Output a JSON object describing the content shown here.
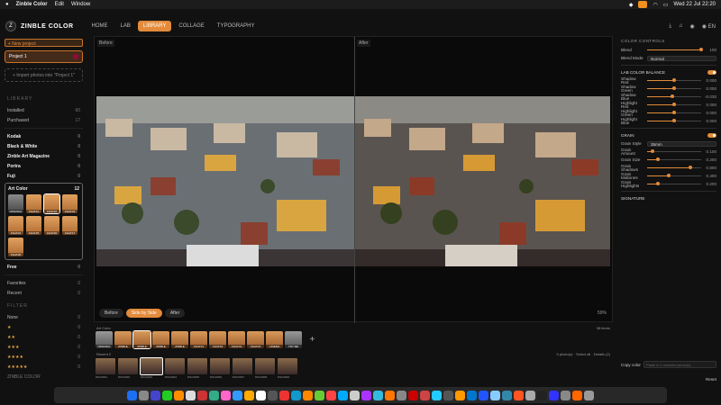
{
  "menubar": {
    "apple": "",
    "app_name": "Zinble Color",
    "items": [
      "Edit",
      "Window"
    ],
    "clock": "Wed 22 Jul 22:20"
  },
  "nav": {
    "brand": "ZINBLE COLOR",
    "tabs": [
      "HOME",
      "LAB",
      "LIBRARY",
      "COLLAGE",
      "TYPOGRAPHY"
    ],
    "active_tab": "LIBRARY",
    "lang": "EN"
  },
  "sidebar": {
    "new_project": "+ New project",
    "project": "Project 1",
    "import": "+ Import photos into \"Project 1\"",
    "library_title": "LIBRARY",
    "library": [
      {
        "label": "Installed",
        "count": "60"
      },
      {
        "label": "Purchased",
        "count": "17"
      }
    ],
    "groups": [
      {
        "label": "Kodak",
        "count": "0"
      },
      {
        "label": "Black & White",
        "count": "0"
      },
      {
        "label": "Zinble Art Magazine",
        "count": "0"
      },
      {
        "label": "Portra",
        "count": "0"
      },
      {
        "label": "Fuji",
        "count": "0"
      }
    ],
    "art_color": {
      "title": "Art Color",
      "count": "12",
      "thumbs": [
        "ORIGINAL",
        "FILM 01",
        "FILM 02",
        "FILM 03",
        "FILM 04",
        "FILM 05",
        "FILM 06",
        "FILM 07",
        "FILM 08",
        "",
        "",
        ""
      ]
    },
    "free": {
      "label": "Free",
      "count": "0"
    },
    "extra": [
      {
        "label": "Favorites",
        "count": "0"
      },
      {
        "label": "Recent",
        "count": "0"
      }
    ],
    "filter_title": "FILTER",
    "filter": [
      {
        "label": "None",
        "count": "0"
      },
      {
        "label": "★",
        "count": "0"
      },
      {
        "label": "★★",
        "count": "0"
      },
      {
        "label": "★★★",
        "count": "0"
      },
      {
        "label": "★★★★",
        "count": "0"
      },
      {
        "label": "★★★★★",
        "count": "0"
      }
    ],
    "footer": "ZINBLE COLOR"
  },
  "viewer": {
    "before": "Before",
    "after": "After",
    "modes": [
      "Before",
      "Side by Side",
      "After"
    ],
    "active_mode": "Side by Side",
    "zoom": "59%"
  },
  "strip": {
    "presets_title": "Art Color",
    "presets_count": "38 items",
    "presets": [
      "ORIGINAL",
      "ZINBLE",
      "ZINBLE",
      "ZINBLE",
      "ZINBLE",
      "FILM 01",
      "FILM 02",
      "FILM 03",
      "FILM 04",
      "CINEMA",
      "TRY ME"
    ],
    "recent_title": "Recent 2",
    "recent_count": "9 photo(s)",
    "select_all": "Select all",
    "details": "Details (2)",
    "photos": [
      "DSC0001",
      "DSC0002",
      "DSC0003",
      "DSC0004",
      "DSC0005",
      "DSC0006",
      "DSC0007",
      "DSC0008",
      "DSC0009"
    ]
  },
  "rpanel": {
    "color_controls": "COLOR CONTROLS",
    "blend": {
      "label": "Blend",
      "value": "100"
    },
    "blend_mode": {
      "label": "Blend Mode",
      "value": "Normal"
    },
    "lab_title": "LAB COLOR BALANCE",
    "lab": [
      {
        "label": "Shadow Red",
        "value": "0.000",
        "pos": 0.5
      },
      {
        "label": "Shadow Green",
        "value": "0.000",
        "pos": 0.5
      },
      {
        "label": "Shadow Blue",
        "value": "-0.030",
        "pos": 0.47
      },
      {
        "label": "Highlight Red",
        "value": "0.000",
        "pos": 0.5
      },
      {
        "label": "Highlight Green",
        "value": "0.000",
        "pos": 0.5
      },
      {
        "label": "Highlight Blue",
        "value": "0.000",
        "pos": 0.5
      }
    ],
    "grain_title": "GRAIN",
    "grain_style": {
      "label": "Grain Style",
      "value": "35mm"
    },
    "grain": [
      {
        "label": "Grain Amount",
        "value": "0.100",
        "pos": 0.1
      },
      {
        "label": "Grain Size",
        "value": "0.200",
        "pos": 0.2
      },
      {
        "label": "Grain Shadows",
        "value": "0.800",
        "pos": 0.8
      },
      {
        "label": "Grain Midtones",
        "value": "0.400",
        "pos": 0.4
      },
      {
        "label": "Grain Highlights",
        "value": "0.200",
        "pos": 0.2
      }
    ],
    "signature_title": "SIGNATURE",
    "copy": "Copy color",
    "paste_placeholder": "Paste in 1 selected photo(s)",
    "reset": "Reset"
  },
  "colors": {
    "accent": "#e38b3a"
  },
  "dock_apps": [
    "#1d6ff2",
    "#888",
    "#44c",
    "#2c2",
    "#ff8c00",
    "#ddd",
    "#c33",
    "#3a8",
    "#f6c",
    "#39f",
    "#fa0",
    "#fff",
    "#555",
    "#e33",
    "#19c",
    "#f80",
    "#6c3",
    "#f44",
    "#0af",
    "#ccc",
    "#a3f",
    "#3bd",
    "#f70",
    "#888",
    "#c00",
    "#c44",
    "#2cf",
    "#555",
    "#f90",
    "#07c",
    "#25f",
    "#8cf",
    "#38a",
    "#f52",
    "#aaa",
    "#222",
    "#33f",
    "#888",
    "#f60",
    "#999"
  ]
}
